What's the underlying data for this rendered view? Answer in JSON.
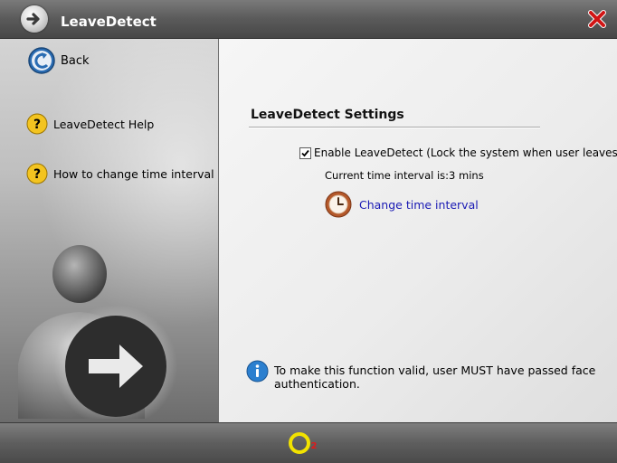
{
  "window": {
    "title": "LeaveDetect",
    "close_icon": "close-icon"
  },
  "sidebar": {
    "back": {
      "label": "Back",
      "icon": "back-arrow-icon"
    },
    "items": [
      {
        "label": "LeaveDetect Help",
        "icon": "help-icon"
      },
      {
        "label": "How to change time interval",
        "icon": "help-icon"
      }
    ],
    "illustration_icon": "user-leave-arrow-icon"
  },
  "main": {
    "section_title": "LeaveDetect Settings",
    "enable_checkbox": {
      "label": "Enable LeaveDetect (Lock the system when user leaves)",
      "checked": true
    },
    "interval_text": "Current time interval is:3 mins",
    "change_link": {
      "label": "Change time interval",
      "icon": "clock-icon"
    },
    "notice": {
      "icon": "info-icon",
      "text": "To make this function valid, user MUST have passed face authentication."
    }
  },
  "footer": {
    "logo_icon": "o2-logo-icon",
    "logo_text": "2"
  },
  "colors": {
    "titlebar": "#555555",
    "link": "#1a1ab4",
    "footer": "#5e5e5e"
  }
}
